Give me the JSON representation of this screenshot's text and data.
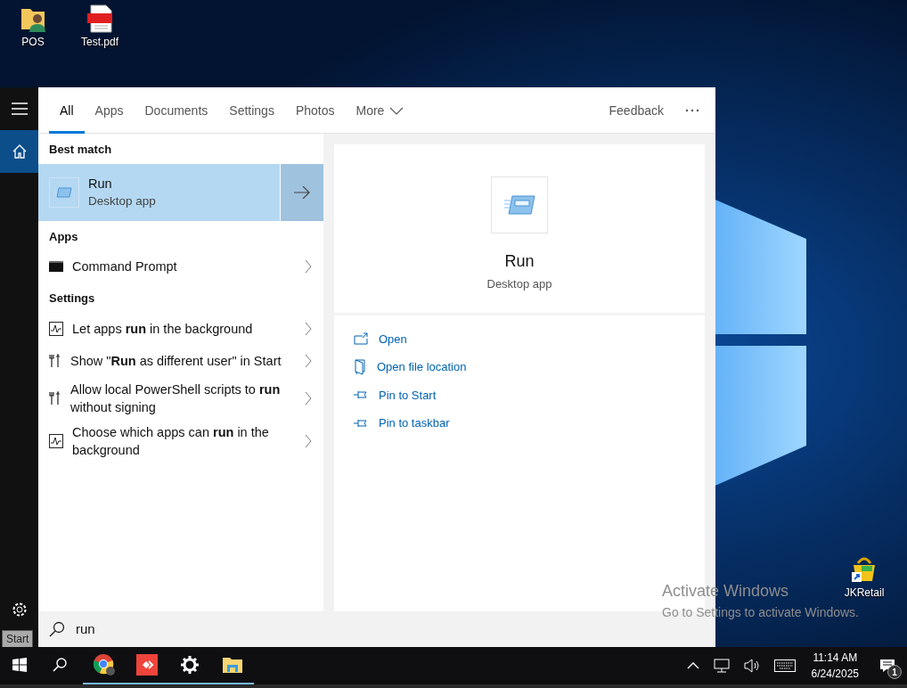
{
  "desktop_icons": [
    {
      "label": "POS",
      "kind": "folder"
    },
    {
      "label": "Test.pdf",
      "kind": "pdf"
    },
    {
      "label": "JKRetail",
      "kind": "shortcut"
    }
  ],
  "start_menu": {
    "rail": [
      {
        "kind": "menu",
        "selected": false
      },
      {
        "kind": "home",
        "selected": true
      },
      {
        "kind": "settings",
        "selected": false
      }
    ],
    "tabs": [
      {
        "label": "All",
        "selected": true,
        "has_menu": false
      },
      {
        "label": "Apps",
        "selected": false,
        "has_menu": false
      },
      {
        "label": "Documents",
        "selected": false,
        "has_menu": false
      },
      {
        "label": "Settings",
        "selected": false,
        "has_menu": false
      },
      {
        "label": "Photos",
        "selected": false,
        "has_menu": false
      },
      {
        "label": "More",
        "selected": false,
        "has_menu": true
      }
    ],
    "feedback": "Feedback",
    "sections": [
      {
        "heading": "Best match",
        "results": [
          {
            "title": "Run",
            "subtitle": "Desktop app",
            "kind": "run",
            "selected": true
          }
        ]
      },
      {
        "heading": "Apps",
        "results": [
          {
            "title": "Command Prompt",
            "kind": "cmd",
            "selected": false
          }
        ]
      },
      {
        "heading": "Settings",
        "results": [
          {
            "title": "Let apps **run** in the background",
            "kind": "activity",
            "selected": false
          },
          {
            "title": "Show \"**Run** as different user\" in Start",
            "kind": "tools",
            "selected": false
          },
          {
            "title": "Allow local PowerShell scripts to **run** without signing",
            "kind": "tools",
            "selected": false
          },
          {
            "title": "Choose which apps can **run** in the background",
            "kind": "activity",
            "selected": false
          }
        ]
      }
    ],
    "preview": {
      "title": "Run",
      "subtitle": "Desktop app",
      "actions": [
        {
          "label": "Open",
          "kind": "open"
        },
        {
          "label": "Open file location",
          "kind": "location"
        },
        {
          "label": "Pin to Start",
          "kind": "pin"
        },
        {
          "label": "Pin to taskbar",
          "kind": "pin"
        }
      ]
    },
    "search": {
      "value": "run"
    }
  },
  "tooltip": "Start",
  "activation": {
    "title": "Activate Windows",
    "message": "Go to Settings to activate Windows."
  },
  "taskbar": {
    "apps": [
      {
        "kind": "chrome",
        "running": true
      },
      {
        "kind": "remote",
        "running": true
      },
      {
        "kind": "settings",
        "running": true
      },
      {
        "kind": "explorer",
        "running": true
      }
    ],
    "time": "11:14 AM",
    "date": "6/24/2025",
    "notifications": "1"
  }
}
